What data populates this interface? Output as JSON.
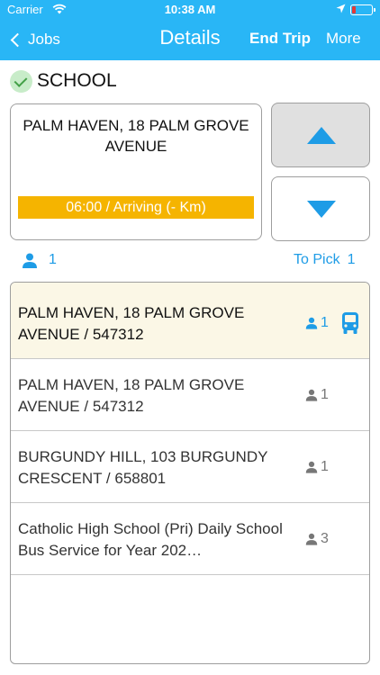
{
  "status_bar": {
    "carrier": "Carrier",
    "time": "10:38 AM",
    "battery_color": "#e53935"
  },
  "nav": {
    "back_label": "Jobs",
    "title": "Details",
    "end_trip": "End Trip",
    "more": "More",
    "bar_color": "#29b6f6"
  },
  "school": {
    "label": "SCHOOL",
    "icon": "check-circle-icon"
  },
  "current_stop": {
    "address": "PALM HAVEN, 18 PALM GROVE AVENUE",
    "status": "06:00 / Arriving (- Km)",
    "status_color": "#f5b400"
  },
  "summary": {
    "passengers": "1",
    "to_pick_label": "To Pick",
    "to_pick_count": "1"
  },
  "stops": [
    {
      "text": "PALM HAVEN, 18 PALM GROVE AVENUE / 547312",
      "pax": "1",
      "active": true,
      "icon": "bus-icon"
    },
    {
      "text": "PALM HAVEN, 18 PALM GROVE AVENUE / 547312",
      "pax": "1",
      "active": false
    },
    {
      "text": "BURGUNDY HILL, 103 BURGUNDY CRESCENT / 658801",
      "pax": "1",
      "active": false
    },
    {
      "text": "Catholic High School (Pri) Daily School Bus Service for Year 202…",
      "pax": "3",
      "active": false
    }
  ],
  "accent_color": "#1e9ce6"
}
